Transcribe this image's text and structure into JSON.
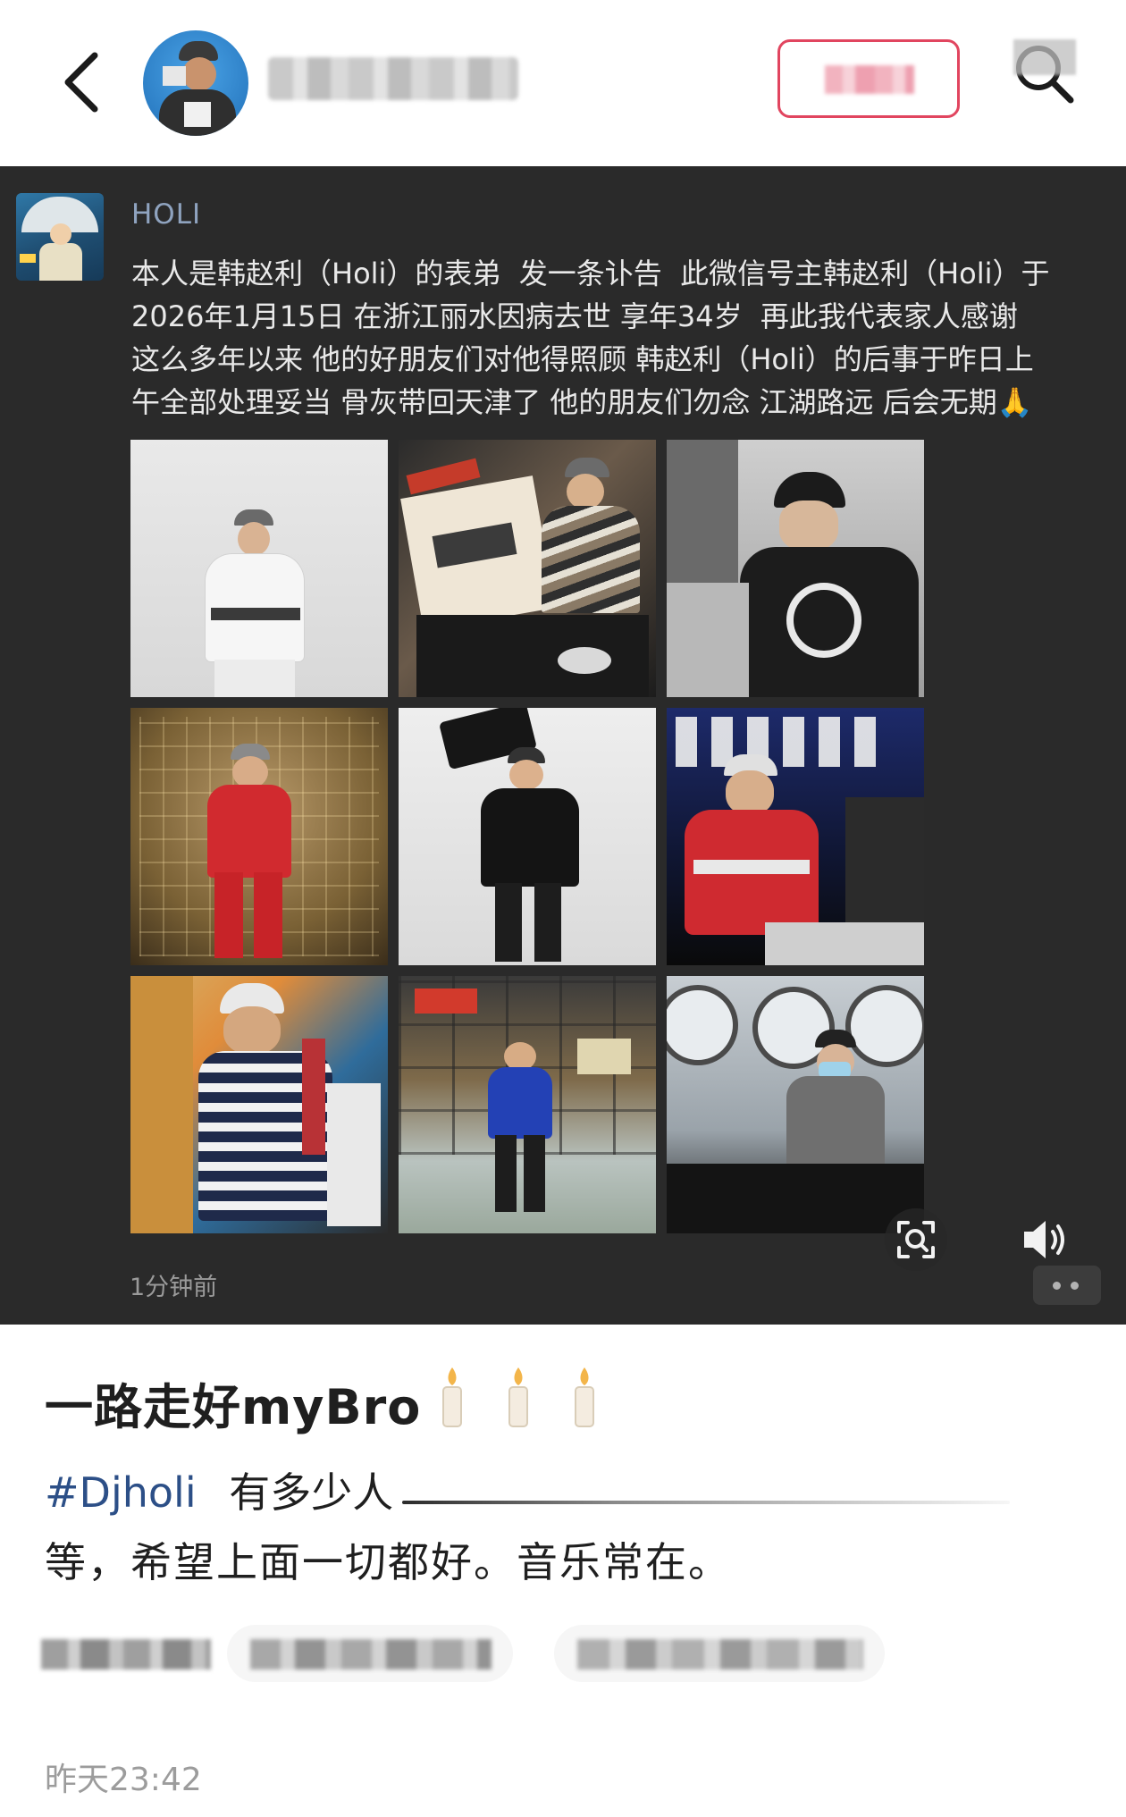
{
  "header": {
    "back_icon": "chevron-left-icon",
    "avatar_desc": "avatar",
    "username": "",
    "follow_label": "",
    "search_icon": "search-icon"
  },
  "post": {
    "poster_name": "HOLI",
    "text": "本人是韩赵利（Holi）的表弟  发一条讣告  此微信号主韩赵利（Holi）于\n2026年1月15日 在浙江丽水因病去世 享年34岁  再此我代表家人感谢\n这么多年以来 他的好朋友们对他得照顾 韩赵利（Holi）的后事于昨日上\n午全部处理妥当 骨灰带回天津了 他的朋友们勿念 江湖路远 后会无期🙏",
    "timestamp": "1分钟前",
    "photos": [
      {
        "name": "photo-1"
      },
      {
        "name": "photo-2"
      },
      {
        "name": "photo-3"
      },
      {
        "name": "photo-4"
      },
      {
        "name": "photo-5"
      },
      {
        "name": "photo-6"
      },
      {
        "name": "photo-7"
      },
      {
        "name": "photo-8"
      },
      {
        "name": "photo-9"
      }
    ],
    "scan_icon": "scan-icon",
    "speaker_icon": "speaker-icon",
    "more_icon": "more-dots-icon"
  },
  "caption": {
    "title": "一路走好myBro",
    "candle_icon": "candle-icon",
    "hashtag": "#Djholi",
    "line1_rest": "有多少人",
    "line2": "等，希望上面一切都好。音乐常在。",
    "time": "昨天23:42"
  },
  "colors": {
    "dark_bg": "#2a2a2a",
    "poster_name": "#8fa3bf",
    "hashtag": "#2c4f87",
    "follow_border": "#e1455f"
  }
}
